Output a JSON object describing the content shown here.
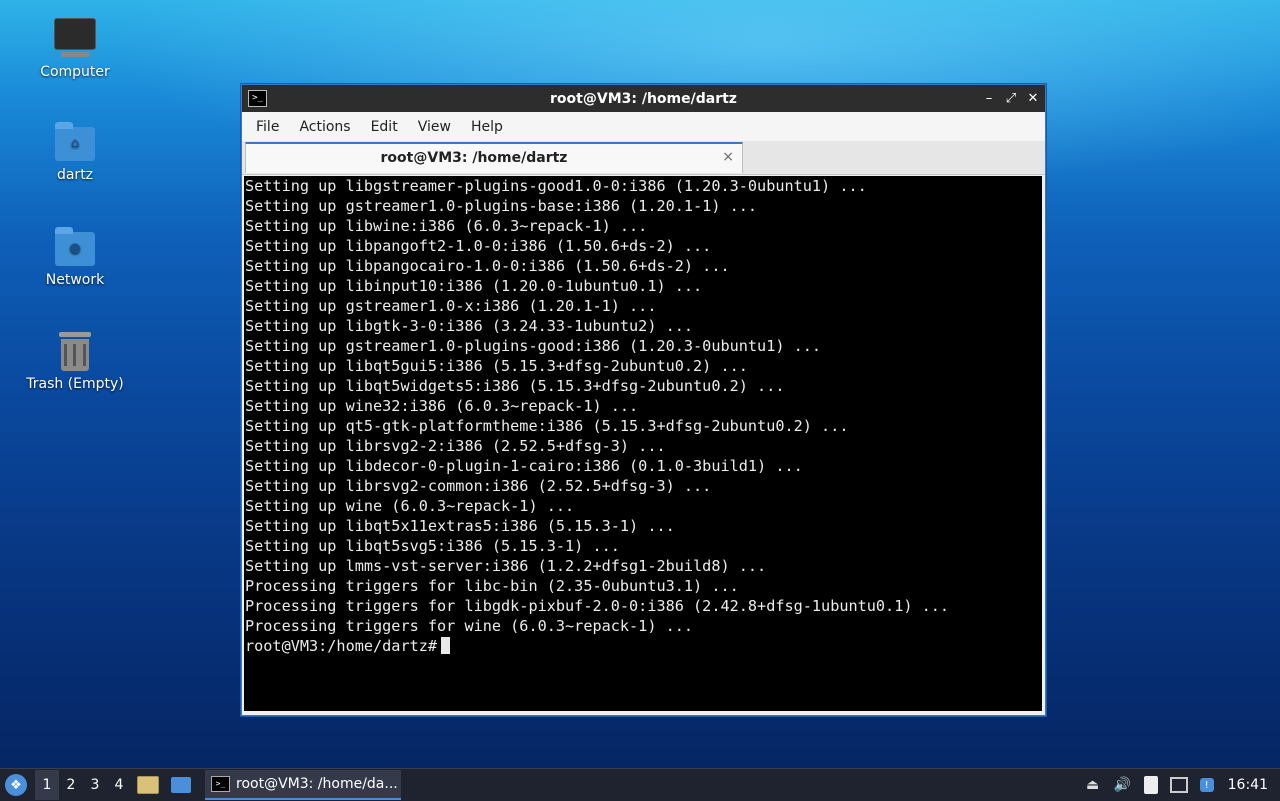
{
  "desktop": {
    "icons": [
      {
        "label": "Computer",
        "icon": "computer-icon"
      },
      {
        "label": "dartz",
        "icon": "home-folder-icon"
      },
      {
        "label": "Network",
        "icon": "network-folder-icon"
      },
      {
        "label": "Trash (Empty)",
        "icon": "trash-icon"
      }
    ]
  },
  "window": {
    "title": "root@VM3: /home/dartz",
    "controls": {
      "minimize": "–",
      "maximize": "⤢",
      "close": "✕"
    },
    "menu": [
      "File",
      "Actions",
      "Edit",
      "View",
      "Help"
    ],
    "tab": {
      "label": "root@VM3: /home/dartz",
      "close": "×"
    },
    "terminal_lines": [
      "Setting up libgstreamer-plugins-good1.0-0:i386 (1.20.3-0ubuntu1) ...",
      "Setting up gstreamer1.0-plugins-base:i386 (1.20.1-1) ...",
      "Setting up libwine:i386 (6.0.3~repack-1) ...",
      "Setting up libpangoft2-1.0-0:i386 (1.50.6+ds-2) ...",
      "Setting up libpangocairo-1.0-0:i386 (1.50.6+ds-2) ...",
      "Setting up libinput10:i386 (1.20.0-1ubuntu0.1) ...",
      "Setting up gstreamer1.0-x:i386 (1.20.1-1) ...",
      "Setting up libgtk-3-0:i386 (3.24.33-1ubuntu2) ...",
      "Setting up gstreamer1.0-plugins-good:i386 (1.20.3-0ubuntu1) ...",
      "Setting up libqt5gui5:i386 (5.15.3+dfsg-2ubuntu0.2) ...",
      "Setting up libqt5widgets5:i386 (5.15.3+dfsg-2ubuntu0.2) ...",
      "Setting up wine32:i386 (6.0.3~repack-1) ...",
      "Setting up qt5-gtk-platformtheme:i386 (5.15.3+dfsg-2ubuntu0.2) ...",
      "Setting up librsvg2-2:i386 (2.52.5+dfsg-3) ...",
      "Setting up libdecor-0-plugin-1-cairo:i386 (0.1.0-3build1) ...",
      "Setting up librsvg2-common:i386 (2.52.5+dfsg-3) ...",
      "Setting up wine (6.0.3~repack-1) ...",
      "Setting up libqt5x11extras5:i386 (5.15.3-1) ...",
      "Setting up libqt5svg5:i386 (5.15.3-1) ...",
      "Setting up lmms-vst-server:i386 (1.2.2+dfsg1-2build8) ...",
      "Processing triggers for libc-bin (2.35-0ubuntu3.1) ...",
      "Processing triggers for libgdk-pixbuf-2.0-0:i386 (2.42.8+dfsg-1ubuntu0.1) ...",
      "Processing triggers for wine (6.0.3~repack-1) ..."
    ],
    "prompt": "root@VM3:/home/dartz#"
  },
  "taskbar": {
    "workspaces": [
      "1",
      "2",
      "3",
      "4"
    ],
    "active_workspace": "1",
    "task_label": "root@VM3: /home/da...",
    "clock": "16:41"
  },
  "colors": {
    "window_border": "#3a78c4",
    "terminal_bg": "#000000",
    "taskbar_bg": "#1f2330"
  }
}
